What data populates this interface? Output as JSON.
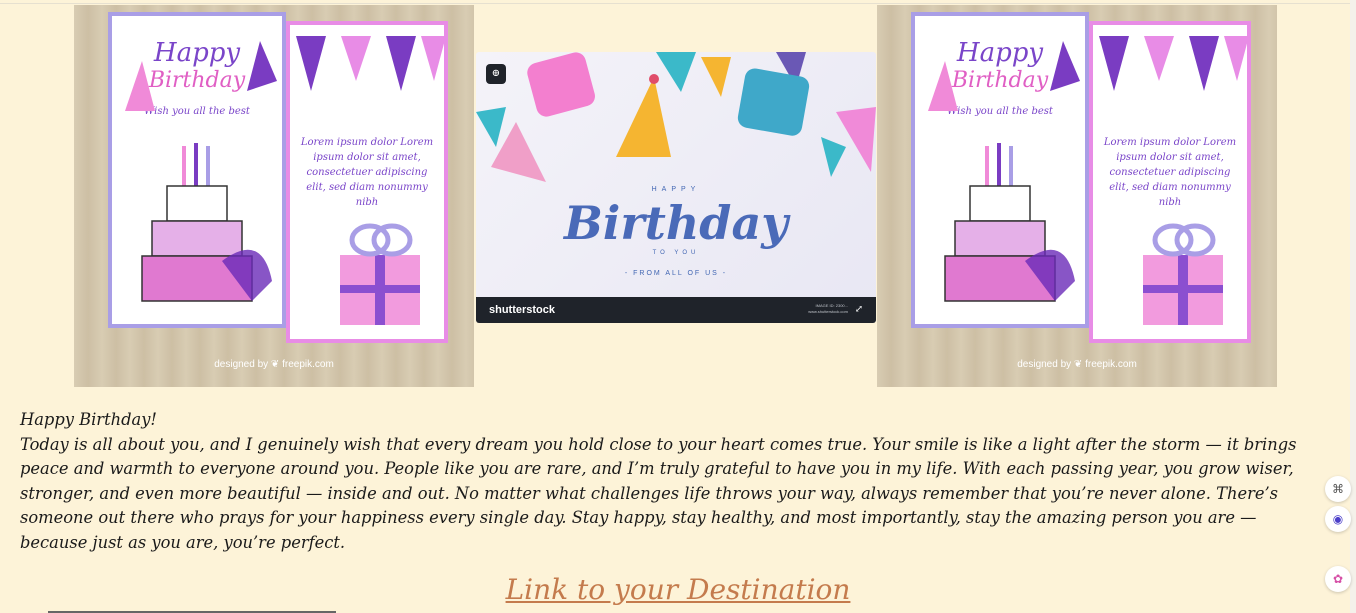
{
  "gallery": {
    "card": {
      "title_line1": "Happy",
      "title_line2": "Birthday",
      "wish": "Wish you all the best",
      "lorem": "Lorem ipsum dolor Lorem ipsum dolor sit amet, consectetuer adipiscing elit, sed diam nonummy nibh",
      "credit": "designed by ❦ freepik.com"
    },
    "stock": {
      "happy": "HAPPY",
      "birthday": "Birthday",
      "to_you": "TO YOU",
      "from": "- FROM ALL OF US -",
      "logo": "shutterstock",
      "meta": "IMAGE ID: 2300...\nwww.shutterstock.com"
    }
  },
  "message": {
    "greeting": "Happy Birthday!",
    "body": "Today is all about you, and I genuinely wish that every dream you hold close to your heart comes true. Your smile is like a light after the storm — it brings peace and warmth to everyone around you. People like you are rare, and I’m truly grateful to have you in my life. With each passing year, you grow wiser, stronger, and even more beautiful — inside and out. No matter what challenges life throws your way, always remember that you’re never alone. There’s someone out there who prays for your happiness every single day. Stay happy, stay healthy, and most importantly, stay the amazing person you are — because just as you are, you’re perfect."
  },
  "link": {
    "label": "Link to your Destination"
  },
  "colors": {
    "background": "#fdf3d8",
    "link": "#c47b4d",
    "text": "#1a1a1a"
  },
  "side_icons": [
    "grid-icon",
    "robot-icon",
    "brain-icon"
  ]
}
